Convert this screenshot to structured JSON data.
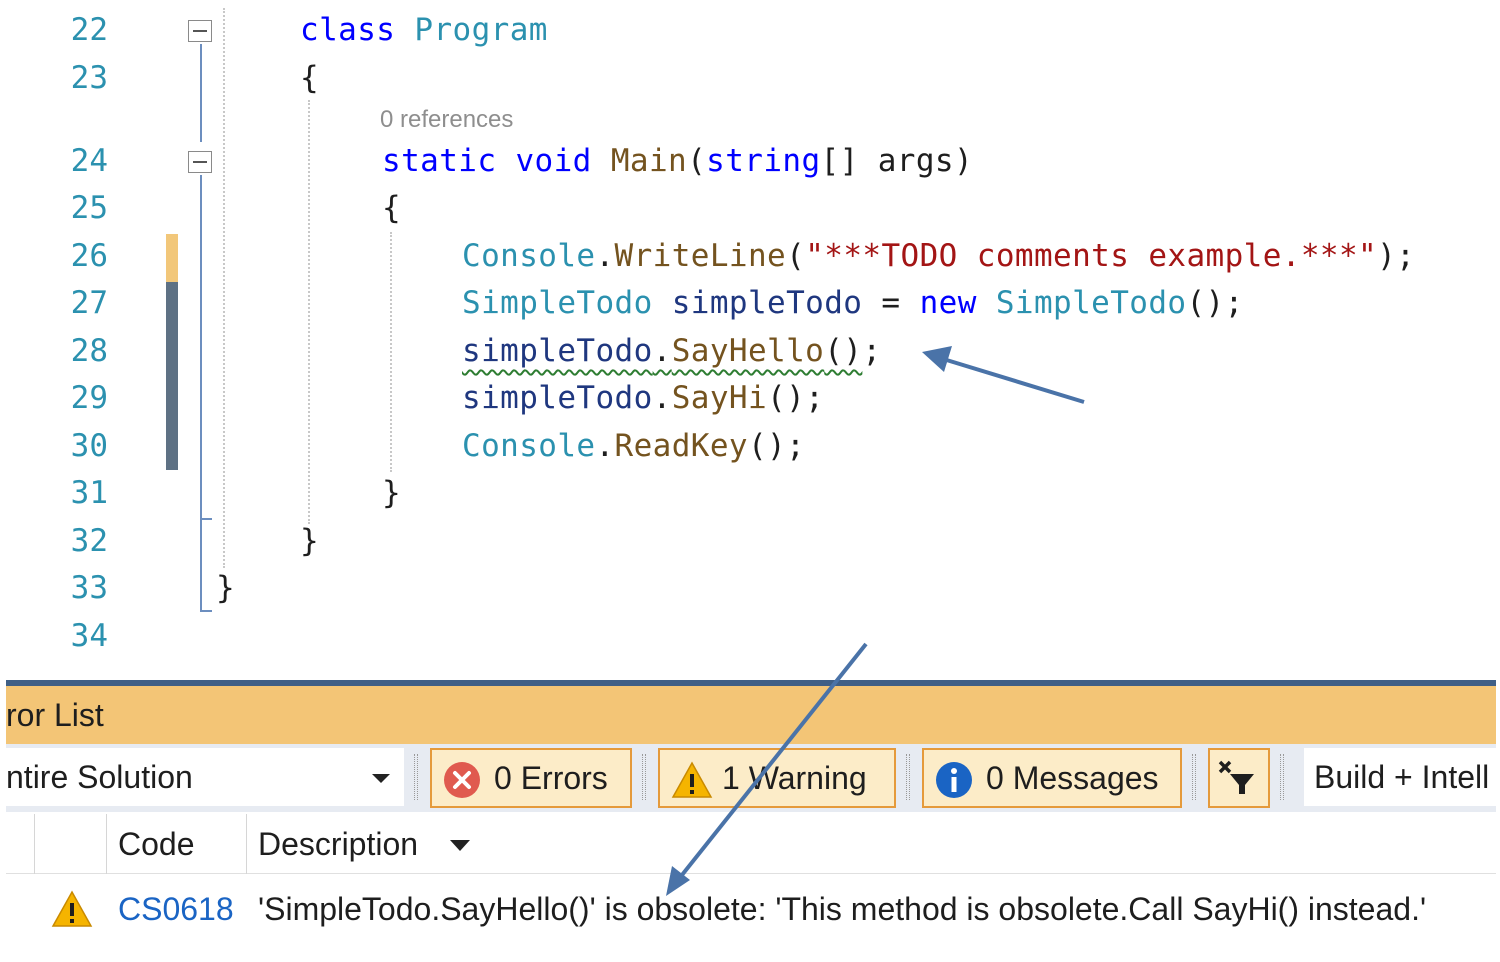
{
  "editor": {
    "line_numbers": [
      "22",
      "23",
      "24",
      "25",
      "26",
      "27",
      "28",
      "29",
      "30",
      "31",
      "32",
      "33",
      "34"
    ],
    "codelens": "0 references",
    "lines": {
      "l22_kw": "class",
      "l22_type": "Program",
      "l23": "{",
      "l24_kw1": "static",
      "l24_kw2": "void",
      "l24_fn": "Main",
      "l24_p1": "(",
      "l24_kw3": "string",
      "l24_rest": "[] args)",
      "l25": "{",
      "l26_type": "Console",
      "l26_dot": ".",
      "l26_fn": "WriteLine",
      "l26_p": "(",
      "l26_str": "\"***TODO comments example.***\"",
      "l26_end": ");",
      "l27_type": "SimpleTodo",
      "l27_var": "simpleTodo",
      "l27_eq": " = ",
      "l27_new": "new",
      "l27_type2": "SimpleTodo",
      "l27_end": "();",
      "l28_var": "simpleTodo",
      "l28_dot": ".",
      "l28_fn": "SayHello",
      "l28_paren": "()",
      "l28_end": ";",
      "l29_var": "simpleTodo",
      "l29_dot": ".",
      "l29_fn": "SayHi",
      "l29_end": "();",
      "l30_type": "Console",
      "l30_dot": ".",
      "l30_fn": "ReadKey",
      "l30_end": "();",
      "l31": "}",
      "l32": "}",
      "l33": "}"
    }
  },
  "error_list": {
    "title": "ror List",
    "scope": "ntire Solution",
    "errors_label": "0 Errors",
    "warnings_label": "1 Warning",
    "messages_label": "0 Messages",
    "build_filter": "Build + Intell",
    "columns": {
      "code": "Code",
      "description": "Description"
    },
    "row": {
      "code": "CS0618",
      "description": "'SimpleTodo.SayHello()' is obsolete: 'This method is obsolete.Call SayHi() instead.'"
    }
  },
  "colors": {
    "line_number": "#2b91af",
    "keyword": "#0000ff",
    "type": "#2b91af",
    "method": "#74531f",
    "string": "#a31515",
    "title_bar": "#f3c576",
    "annotation_arrow": "#4a73a8"
  }
}
